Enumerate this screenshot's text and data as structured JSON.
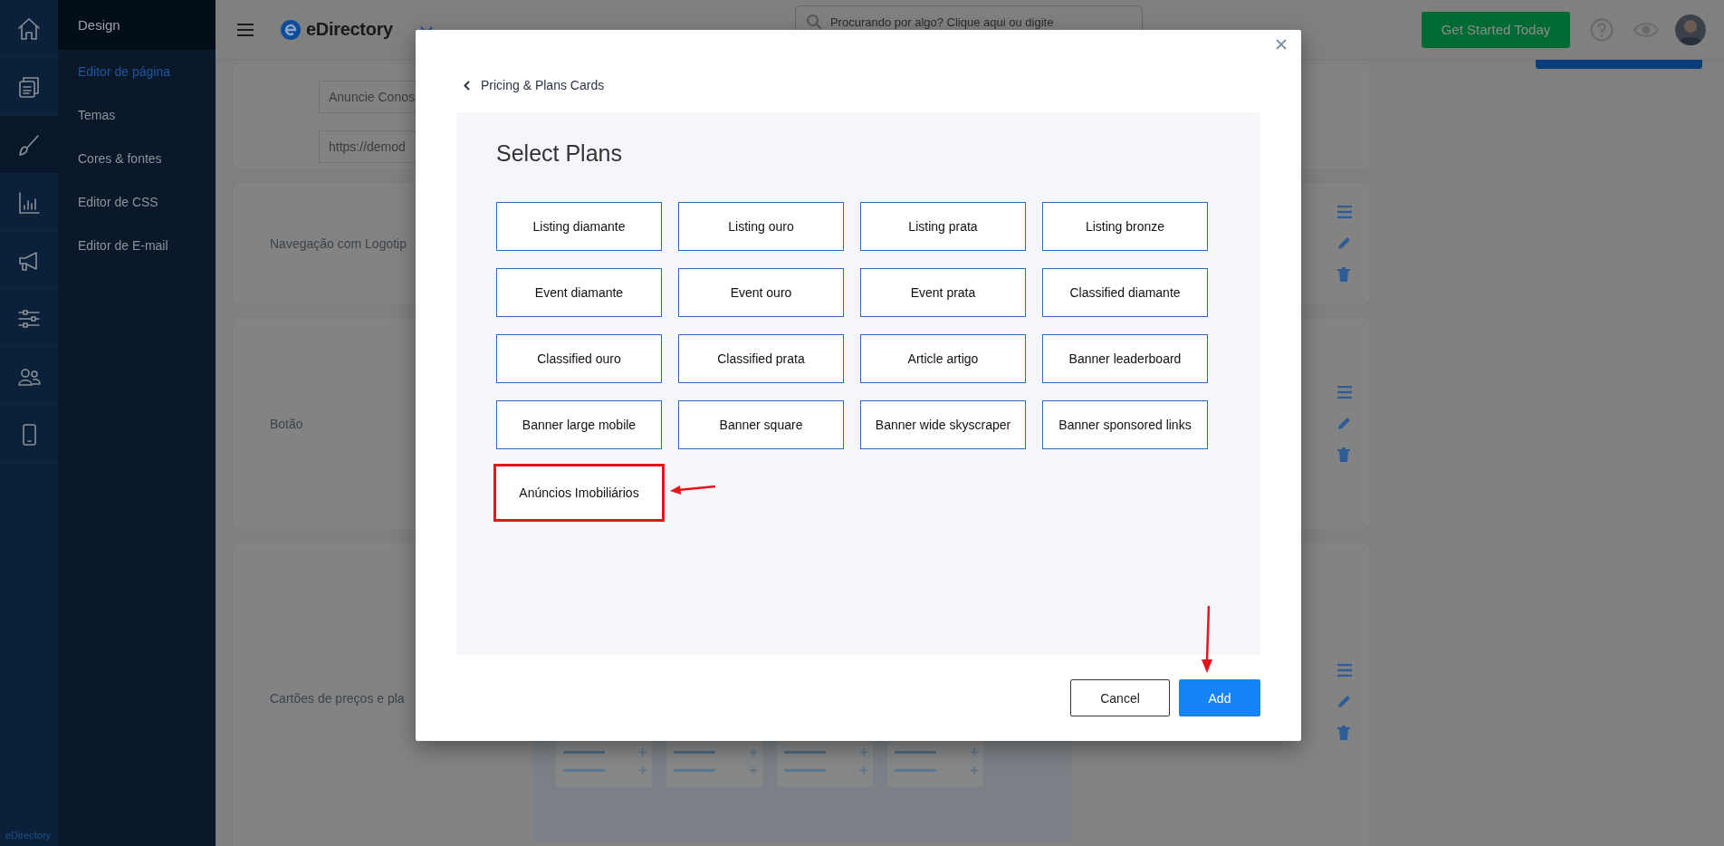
{
  "rail": {
    "items": [
      {
        "kind": "home",
        "selected": false
      },
      {
        "kind": "pages",
        "selected": false
      },
      {
        "kind": "brush",
        "selected": true
      },
      {
        "kind": "chart",
        "selected": false
      },
      {
        "kind": "megaphone",
        "selected": false
      },
      {
        "kind": "sliders",
        "selected": false
      },
      {
        "kind": "users",
        "selected": false
      },
      {
        "kind": "phone",
        "selected": false
      }
    ],
    "footer": "eDirectory"
  },
  "submenu": {
    "title": "Design",
    "items": [
      {
        "label": "Editor de página",
        "selected": true
      },
      {
        "label": "Temas",
        "selected": false
      },
      {
        "label": "Cores & fontes",
        "selected": false
      },
      {
        "label": "Editor de CSS",
        "selected": false
      },
      {
        "label": "Editor de E-mail",
        "selected": false
      }
    ]
  },
  "topbar": {
    "brand": "eDirectory",
    "search": {
      "placeholder": "Procurando por algo? Clique aqui ou digite"
    },
    "cta": "Get Started Today"
  },
  "page": {
    "fields": [
      "Anuncie Conos",
      "https://demod"
    ],
    "sections": [
      {
        "label": "Navegação com Logotip"
      },
      {
        "label": "Botão"
      },
      {
        "label": "Cartões de preços e pla"
      }
    ]
  },
  "modal": {
    "back": "Pricing & Plans Cards",
    "title": "Select Plans",
    "plans": [
      {
        "label": "Listing diamante",
        "highlighted": false
      },
      {
        "label": "Listing ouro",
        "highlighted": false
      },
      {
        "label": "Listing prata",
        "highlighted": false
      },
      {
        "label": "Listing bronze",
        "highlighted": false
      },
      {
        "label": "Event diamante",
        "highlighted": false
      },
      {
        "label": "Event ouro",
        "highlighted": false
      },
      {
        "label": "Event prata",
        "highlighted": false
      },
      {
        "label": "Classified diamante",
        "highlighted": false
      },
      {
        "label": "Classified ouro",
        "highlighted": false
      },
      {
        "label": "Classified prata",
        "highlighted": false
      },
      {
        "label": "Article artigo",
        "highlighted": false
      },
      {
        "label": "Banner leaderboard",
        "highlighted": false
      },
      {
        "label": "Banner large mobile",
        "highlighted": false
      },
      {
        "label": "Banner square",
        "highlighted": false
      },
      {
        "label": "Banner wide skyscraper",
        "highlighted": false
      },
      {
        "label": "Banner sponsored links",
        "highlighted": false
      },
      {
        "label": "Anúncios Imobiliários",
        "highlighted": true
      }
    ],
    "buttons": [
      {
        "label": "Cancel",
        "kind": "secondary",
        "annotated": false
      },
      {
        "label": "Add",
        "kind": "primary",
        "annotated": true
      }
    ]
  }
}
